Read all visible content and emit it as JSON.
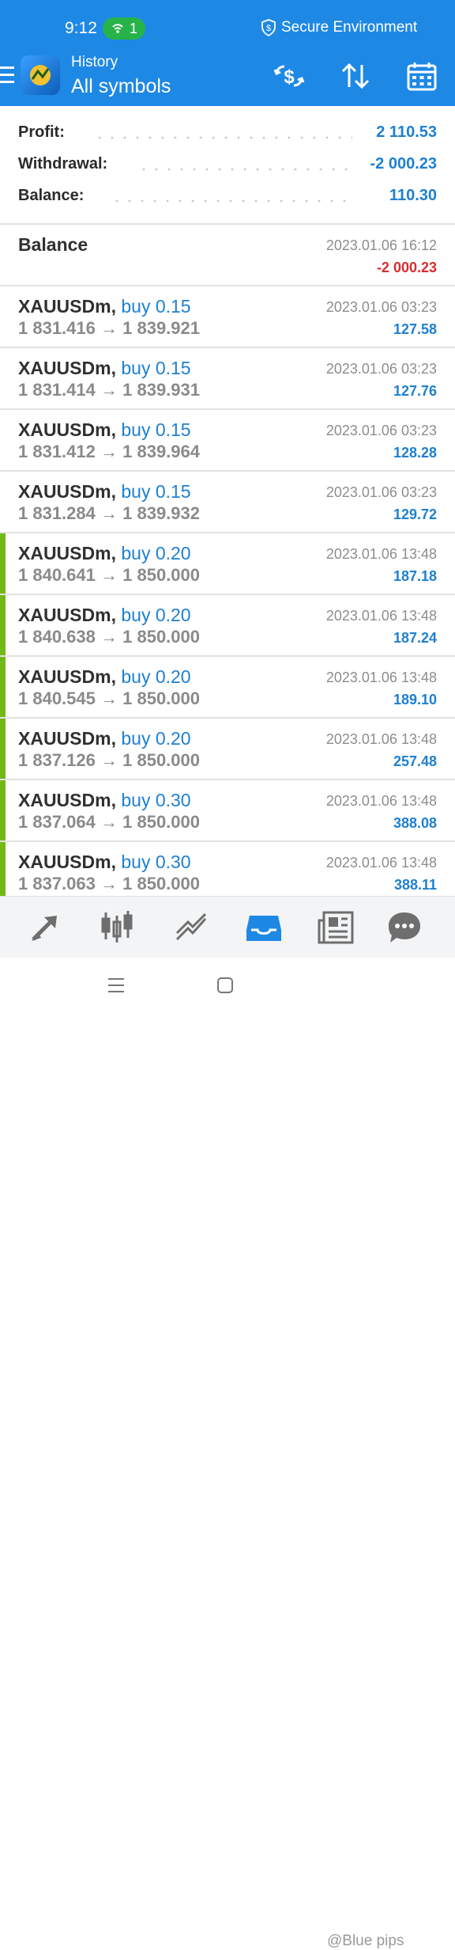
{
  "status_bar": {
    "time": "9:12",
    "hotspot_count": "1",
    "secure_text": "Secure Environment"
  },
  "header": {
    "subtitle": "History",
    "title": "All symbols"
  },
  "summary": [
    {
      "label": "Profit:",
      "value": "2 110.53"
    },
    {
      "label": "Withdrawal:",
      "value": "-2 000.23"
    },
    {
      "label": "Balance:",
      "value": "110.30"
    }
  ],
  "balance_entry": {
    "label": "Balance",
    "date": "2023.01.06 16:12",
    "amount": "-2 000.23"
  },
  "trades": [
    {
      "symbol": "XAUUSDm,",
      "side": "buy 0.15",
      "open": "1 831.416",
      "close": "1 839.921",
      "date": "2023.01.06 03:23",
      "profit": "127.58",
      "marked": false
    },
    {
      "symbol": "XAUUSDm,",
      "side": "buy 0.15",
      "open": "1 831.414",
      "close": "1 839.931",
      "date": "2023.01.06 03:23",
      "profit": "127.76",
      "marked": false
    },
    {
      "symbol": "XAUUSDm,",
      "side": "buy 0.15",
      "open": "1 831.412",
      "close": "1 839.964",
      "date": "2023.01.06 03:23",
      "profit": "128.28",
      "marked": false
    },
    {
      "symbol": "XAUUSDm,",
      "side": "buy 0.15",
      "open": "1 831.284",
      "close": "1 839.932",
      "date": "2023.01.06 03:23",
      "profit": "129.72",
      "marked": false
    },
    {
      "symbol": "XAUUSDm,",
      "side": "buy 0.20",
      "open": "1 840.641",
      "close": "1 850.000",
      "date": "2023.01.06 13:48",
      "profit": "187.18",
      "marked": true
    },
    {
      "symbol": "XAUUSDm,",
      "side": "buy 0.20",
      "open": "1 840.638",
      "close": "1 850.000",
      "date": "2023.01.06 13:48",
      "profit": "187.24",
      "marked": true
    },
    {
      "symbol": "XAUUSDm,",
      "side": "buy 0.20",
      "open": "1 840.545",
      "close": "1 850.000",
      "date": "2023.01.06 13:48",
      "profit": "189.10",
      "marked": true
    },
    {
      "symbol": "XAUUSDm,",
      "side": "buy 0.20",
      "open": "1 837.126",
      "close": "1 850.000",
      "date": "2023.01.06 13:48",
      "profit": "257.48",
      "marked": true
    },
    {
      "symbol": "XAUUSDm,",
      "side": "buy 0.30",
      "open": "1 837.064",
      "close": "1 850.000",
      "date": "2023.01.06 13:48",
      "profit": "388.08",
      "marked": true
    },
    {
      "symbol": "XAUUSDm,",
      "side": "buy 0.30",
      "open": "1 837.063",
      "close": "1 850.000",
      "date": "2023.01.06 13:48",
      "profit": "388.11",
      "marked": true
    }
  ],
  "arrow": "→",
  "bottom_nav": [
    {
      "icon": "quotes-icon"
    },
    {
      "icon": "chart-candles-icon"
    },
    {
      "icon": "trade-icon"
    },
    {
      "icon": "history-inbox-icon",
      "active": true
    },
    {
      "icon": "news-icon"
    },
    {
      "icon": "chat-icon"
    }
  ],
  "watermark": "@Blue pips",
  "colors": {
    "accent": "#1e88e5",
    "profit": "#1e80d0",
    "loss": "#d32f2f",
    "marker": "#74b816"
  }
}
